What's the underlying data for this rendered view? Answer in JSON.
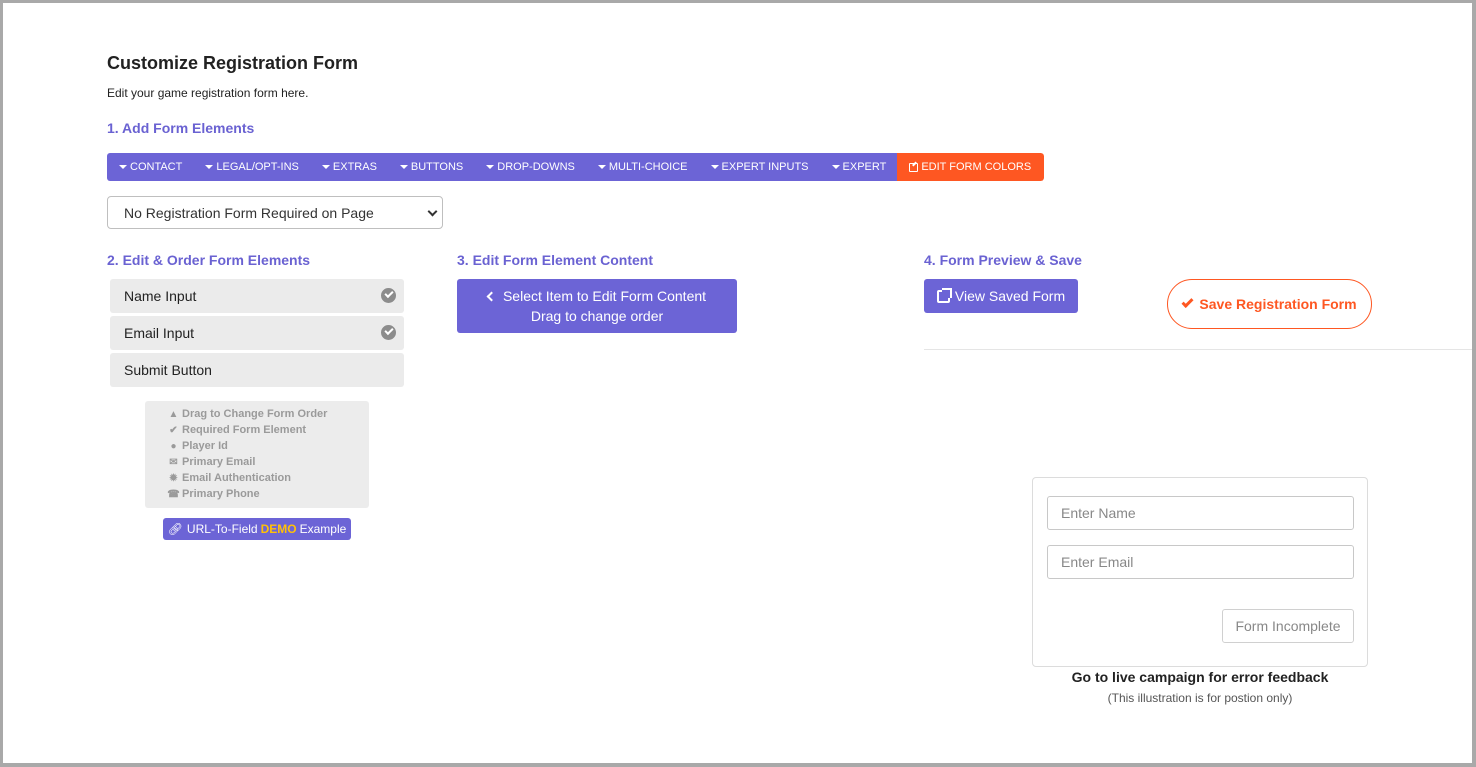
{
  "header": {
    "title": "Customize Registration Form",
    "subtitle": "Edit your game registration form here."
  },
  "sections": {
    "add": "1. Add Form Elements",
    "edit_order": "2. Edit & Order Form Elements",
    "edit_content": "3. Edit Form Element Content",
    "preview_save": "4. Form Preview & Save"
  },
  "toolbar": {
    "items": [
      "CONTACT",
      "LEGAL/OPT-INS",
      "EXTRAS",
      "BUTTONS",
      "DROP-DOWNS",
      "MULTI-CHOICE",
      "EXPERT INPUTS",
      "EXPERT"
    ],
    "edit_colors": "EDIT FORM COLORS",
    "accent": "#6c64d6",
    "highlight": "#fe5722"
  },
  "form_select": {
    "selected": "No Registration Form Required on Page"
  },
  "form_elements": [
    {
      "label": "Name Input",
      "required": true
    },
    {
      "label": "Email Input",
      "required": true
    },
    {
      "label": "Submit Button",
      "required": false
    }
  ],
  "legend": [
    {
      "icon": "chevron-up-icon",
      "label": "Drag to Change Form Order"
    },
    {
      "icon": "check-circle-icon",
      "label": "Required Form Element"
    },
    {
      "icon": "user-icon",
      "label": "Player Id"
    },
    {
      "icon": "envelope-icon",
      "label": "Primary Email"
    },
    {
      "icon": "certificate-icon",
      "label": "Email Authentication"
    },
    {
      "icon": "phone-icon",
      "label": "Primary Phone"
    }
  ],
  "url_demo": {
    "prefix": "URL-To-Field",
    "demo": "DEMO",
    "suffix": "Example"
  },
  "edit_panel": {
    "line1": "Select Item to Edit Form Content",
    "line2": "Drag to change order"
  },
  "preview": {
    "view_saved": "View Saved Form",
    "save": "Save Registration Form",
    "name_placeholder": "Enter Name",
    "email_placeholder": "Enter Email",
    "submit": "Form Incomplete",
    "error_note": "Go to live campaign for error feedback",
    "illustration_note": "(This illustration is for postion only)"
  }
}
